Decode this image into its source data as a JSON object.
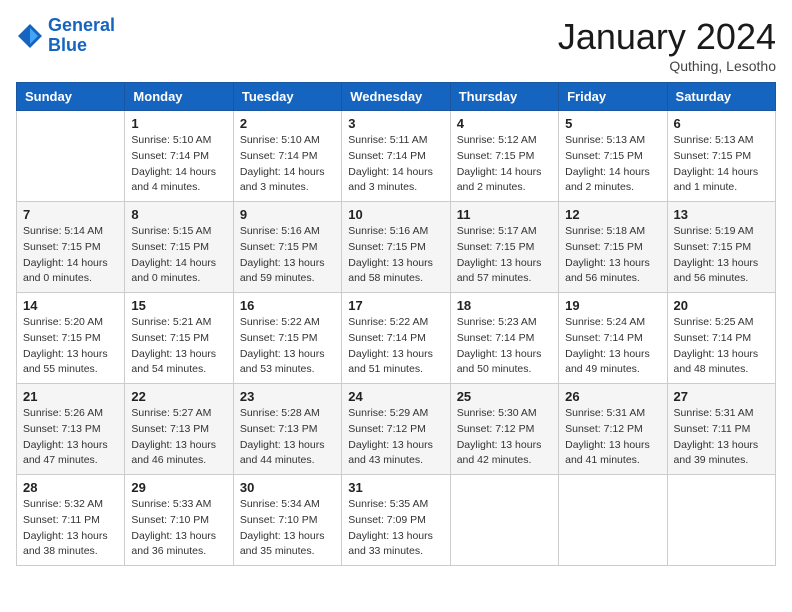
{
  "header": {
    "logo_line1": "General",
    "logo_line2": "Blue",
    "month_title": "January 2024",
    "location": "Quthing, Lesotho"
  },
  "weekdays": [
    "Sunday",
    "Monday",
    "Tuesday",
    "Wednesday",
    "Thursday",
    "Friday",
    "Saturday"
  ],
  "rows": [
    {
      "alt": false,
      "cells": [
        {
          "day": "",
          "lines": []
        },
        {
          "day": "1",
          "lines": [
            "Sunrise: 5:10 AM",
            "Sunset: 7:14 PM",
            "Daylight: 14 hours",
            "and 4 minutes."
          ]
        },
        {
          "day": "2",
          "lines": [
            "Sunrise: 5:10 AM",
            "Sunset: 7:14 PM",
            "Daylight: 14 hours",
            "and 3 minutes."
          ]
        },
        {
          "day": "3",
          "lines": [
            "Sunrise: 5:11 AM",
            "Sunset: 7:14 PM",
            "Daylight: 14 hours",
            "and 3 minutes."
          ]
        },
        {
          "day": "4",
          "lines": [
            "Sunrise: 5:12 AM",
            "Sunset: 7:15 PM",
            "Daylight: 14 hours",
            "and 2 minutes."
          ]
        },
        {
          "day": "5",
          "lines": [
            "Sunrise: 5:13 AM",
            "Sunset: 7:15 PM",
            "Daylight: 14 hours",
            "and 2 minutes."
          ]
        },
        {
          "day": "6",
          "lines": [
            "Sunrise: 5:13 AM",
            "Sunset: 7:15 PM",
            "Daylight: 14 hours",
            "and 1 minute."
          ]
        }
      ]
    },
    {
      "alt": true,
      "cells": [
        {
          "day": "7",
          "lines": [
            "Sunrise: 5:14 AM",
            "Sunset: 7:15 PM",
            "Daylight: 14 hours",
            "and 0 minutes."
          ]
        },
        {
          "day": "8",
          "lines": [
            "Sunrise: 5:15 AM",
            "Sunset: 7:15 PM",
            "Daylight: 14 hours",
            "and 0 minutes."
          ]
        },
        {
          "day": "9",
          "lines": [
            "Sunrise: 5:16 AM",
            "Sunset: 7:15 PM",
            "Daylight: 13 hours",
            "and 59 minutes."
          ]
        },
        {
          "day": "10",
          "lines": [
            "Sunrise: 5:16 AM",
            "Sunset: 7:15 PM",
            "Daylight: 13 hours",
            "and 58 minutes."
          ]
        },
        {
          "day": "11",
          "lines": [
            "Sunrise: 5:17 AM",
            "Sunset: 7:15 PM",
            "Daylight: 13 hours",
            "and 57 minutes."
          ]
        },
        {
          "day": "12",
          "lines": [
            "Sunrise: 5:18 AM",
            "Sunset: 7:15 PM",
            "Daylight: 13 hours",
            "and 56 minutes."
          ]
        },
        {
          "day": "13",
          "lines": [
            "Sunrise: 5:19 AM",
            "Sunset: 7:15 PM",
            "Daylight: 13 hours",
            "and 56 minutes."
          ]
        }
      ]
    },
    {
      "alt": false,
      "cells": [
        {
          "day": "14",
          "lines": [
            "Sunrise: 5:20 AM",
            "Sunset: 7:15 PM",
            "Daylight: 13 hours",
            "and 55 minutes."
          ]
        },
        {
          "day": "15",
          "lines": [
            "Sunrise: 5:21 AM",
            "Sunset: 7:15 PM",
            "Daylight: 13 hours",
            "and 54 minutes."
          ]
        },
        {
          "day": "16",
          "lines": [
            "Sunrise: 5:22 AM",
            "Sunset: 7:15 PM",
            "Daylight: 13 hours",
            "and 53 minutes."
          ]
        },
        {
          "day": "17",
          "lines": [
            "Sunrise: 5:22 AM",
            "Sunset: 7:14 PM",
            "Daylight: 13 hours",
            "and 51 minutes."
          ]
        },
        {
          "day": "18",
          "lines": [
            "Sunrise: 5:23 AM",
            "Sunset: 7:14 PM",
            "Daylight: 13 hours",
            "and 50 minutes."
          ]
        },
        {
          "day": "19",
          "lines": [
            "Sunrise: 5:24 AM",
            "Sunset: 7:14 PM",
            "Daylight: 13 hours",
            "and 49 minutes."
          ]
        },
        {
          "day": "20",
          "lines": [
            "Sunrise: 5:25 AM",
            "Sunset: 7:14 PM",
            "Daylight: 13 hours",
            "and 48 minutes."
          ]
        }
      ]
    },
    {
      "alt": true,
      "cells": [
        {
          "day": "21",
          "lines": [
            "Sunrise: 5:26 AM",
            "Sunset: 7:13 PM",
            "Daylight: 13 hours",
            "and 47 minutes."
          ]
        },
        {
          "day": "22",
          "lines": [
            "Sunrise: 5:27 AM",
            "Sunset: 7:13 PM",
            "Daylight: 13 hours",
            "and 46 minutes."
          ]
        },
        {
          "day": "23",
          "lines": [
            "Sunrise: 5:28 AM",
            "Sunset: 7:13 PM",
            "Daylight: 13 hours",
            "and 44 minutes."
          ]
        },
        {
          "day": "24",
          "lines": [
            "Sunrise: 5:29 AM",
            "Sunset: 7:12 PM",
            "Daylight: 13 hours",
            "and 43 minutes."
          ]
        },
        {
          "day": "25",
          "lines": [
            "Sunrise: 5:30 AM",
            "Sunset: 7:12 PM",
            "Daylight: 13 hours",
            "and 42 minutes."
          ]
        },
        {
          "day": "26",
          "lines": [
            "Sunrise: 5:31 AM",
            "Sunset: 7:12 PM",
            "Daylight: 13 hours",
            "and 41 minutes."
          ]
        },
        {
          "day": "27",
          "lines": [
            "Sunrise: 5:31 AM",
            "Sunset: 7:11 PM",
            "Daylight: 13 hours",
            "and 39 minutes."
          ]
        }
      ]
    },
    {
      "alt": false,
      "cells": [
        {
          "day": "28",
          "lines": [
            "Sunrise: 5:32 AM",
            "Sunset: 7:11 PM",
            "Daylight: 13 hours",
            "and 38 minutes."
          ]
        },
        {
          "day": "29",
          "lines": [
            "Sunrise: 5:33 AM",
            "Sunset: 7:10 PM",
            "Daylight: 13 hours",
            "and 36 minutes."
          ]
        },
        {
          "day": "30",
          "lines": [
            "Sunrise: 5:34 AM",
            "Sunset: 7:10 PM",
            "Daylight: 13 hours",
            "and 35 minutes."
          ]
        },
        {
          "day": "31",
          "lines": [
            "Sunrise: 5:35 AM",
            "Sunset: 7:09 PM",
            "Daylight: 13 hours",
            "and 33 minutes."
          ]
        },
        {
          "day": "",
          "lines": []
        },
        {
          "day": "",
          "lines": []
        },
        {
          "day": "",
          "lines": []
        }
      ]
    }
  ]
}
